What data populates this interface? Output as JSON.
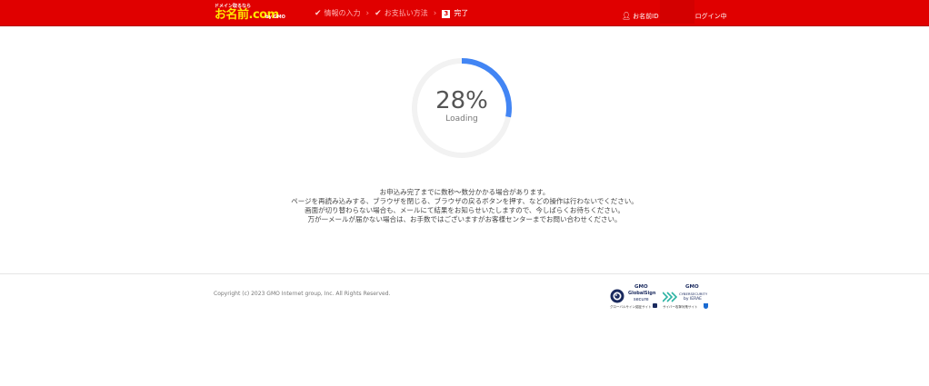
{
  "header": {
    "logo_tagline": "ドメイン取るなら",
    "logo_text": "お名前.com",
    "logo_by": "by GMO",
    "steps": [
      {
        "label": "情報の入力",
        "state": "done"
      },
      {
        "label": "お支払い方法",
        "state": "done"
      },
      {
        "number": "3",
        "label": "完了",
        "state": "current"
      }
    ],
    "user_prefix": "お名前ID",
    "user_status": "ログイン中"
  },
  "progress": {
    "percent_text": "28%",
    "percent_value": 0.28,
    "label": "Loading",
    "colors": {
      "arc": "#4285f4",
      "track": "#f2f2f2"
    }
  },
  "messages": [
    "お申込み完了までに数秒〜数分かかる場合があります。",
    "ページを再読み込みする、ブラウザを閉じる、ブラウザの戻るボタンを押す、などの操作は行わないでください。",
    "画面が切り替わらない場合も、メールにて結果をお知らせいたしますので、今しばらくお待ちください。",
    "万が一メールが届かない場合は、お手数ではございますがお客様センターまでお問い合わせください。"
  ],
  "footer": {
    "copyright": "Copyright (c) 2023 GMO Internet group, Inc. All Rights Reserved.",
    "badge_globalsign": {
      "brand": "GMO",
      "line1": "GlobalSign",
      "line2": "secure",
      "caption": "グローバルサイン認証サイト"
    },
    "badge_cybersecurity": {
      "brand": "GMO",
      "line1": "CYBERSECURITY",
      "line2": "by IERAE",
      "caption": "サイバー攻撃対策サイト"
    }
  },
  "colors": {
    "header_bg": "#e00000",
    "logo": "#ffe600"
  }
}
